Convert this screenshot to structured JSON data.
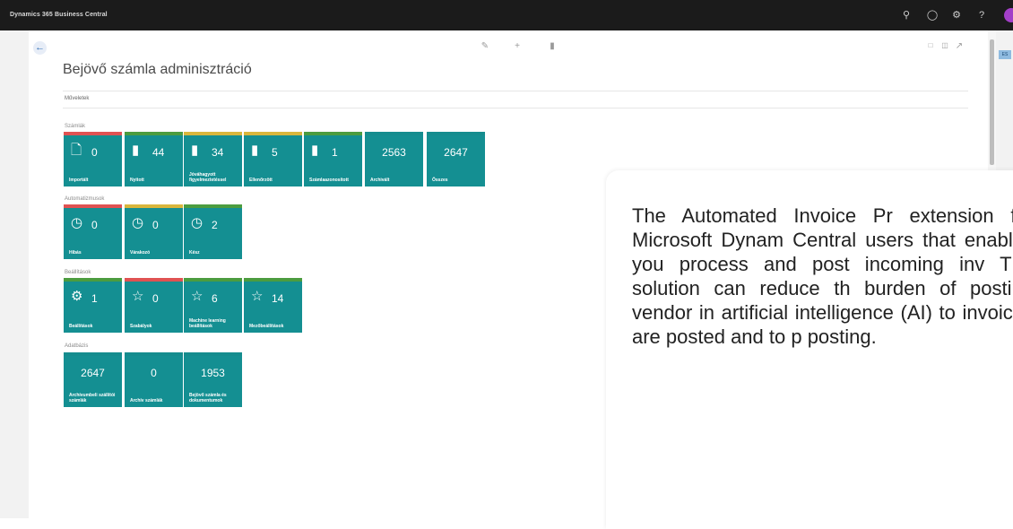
{
  "window": {
    "title": "Dynamics 365 Business Central"
  },
  "topbar": {
    "icons": [
      "search-icon",
      "bell-icon",
      "gear-icon",
      "help-icon",
      "avatar"
    ]
  },
  "page": {
    "title": "Bejövő számla adminisztráció",
    "actions_label": "Műveletek",
    "toolbar_icons": [
      "edit-icon",
      "add-icon",
      "bookmark-icon"
    ],
    "view_icons": [
      "window-icon",
      "split-icon",
      "expand-icon"
    ],
    "right_tag": "ES"
  },
  "groups": [
    {
      "label": "Számlák",
      "tiles": [
        {
          "value": "0",
          "label": "Importált",
          "icon": "doc-outline-icon",
          "bar": "red"
        },
        {
          "value": "44",
          "label": "Nyitott",
          "icon": "doc-filled-icon",
          "bar": "green"
        },
        {
          "value": "34",
          "label": "Jóváhagyott figyelmeztetéssel",
          "icon": "doc-filled-icon",
          "bar": "yellow"
        },
        {
          "value": "5",
          "label": "Ellenőrzött",
          "icon": "doc-filled-icon",
          "bar": "yellow"
        },
        {
          "value": "1",
          "label": "Számlaazonosított",
          "icon": "doc-filled-icon",
          "bar": "green"
        },
        {
          "value": "2563",
          "label": "Archivált",
          "icon": "",
          "bar": ""
        },
        {
          "value": "2647",
          "label": "Összes",
          "icon": "",
          "bar": ""
        }
      ]
    },
    {
      "label": "Automatizmusok",
      "tiles": [
        {
          "value": "0",
          "label": "Hibás",
          "icon": "clock-icon",
          "bar": "red"
        },
        {
          "value": "0",
          "label": "Várakozó",
          "icon": "clock-icon",
          "bar": "yellow"
        },
        {
          "value": "2",
          "label": "Kész",
          "icon": "clock-icon",
          "bar": "green"
        }
      ]
    },
    {
      "label": "Beállítások",
      "tiles": [
        {
          "value": "1",
          "label": "Beállítások",
          "icon": "gear-icon",
          "bar": "green"
        },
        {
          "value": "0",
          "label": "Szabályok",
          "icon": "star-icon",
          "bar": "red"
        },
        {
          "value": "6",
          "label": "Machine learning beállítások",
          "icon": "star-icon",
          "bar": "green"
        },
        {
          "value": "14",
          "label": "Mezőbeállítások",
          "icon": "star-icon",
          "bar": "green"
        }
      ]
    },
    {
      "label": "Adatbázis",
      "tiles": [
        {
          "value": "2647",
          "label": "Archívumbeli szállítói számlák",
          "icon": "",
          "bar": ""
        },
        {
          "value": "0",
          "label": "Archív számlák",
          "icon": "",
          "bar": ""
        },
        {
          "value": "1953",
          "label": "Bejövő számla és dokumentumok",
          "icon": "",
          "bar": ""
        }
      ]
    }
  ],
  "overlay": {
    "text": "The Automated Invoice Pr extension for Microsoft Dynam Central users that enables you process and post incoming inv The solution can reduce th burden of posting vendor in artificial intelligence (AI) to invoices are posted and to p posting."
  },
  "colors": {
    "tile": "#148f92",
    "topbar": "#1b1b1b",
    "status_red": "#e05252",
    "status_yellow": "#d9b63c",
    "status_green": "#4c9c3f",
    "avatar": "#a33fc8"
  }
}
